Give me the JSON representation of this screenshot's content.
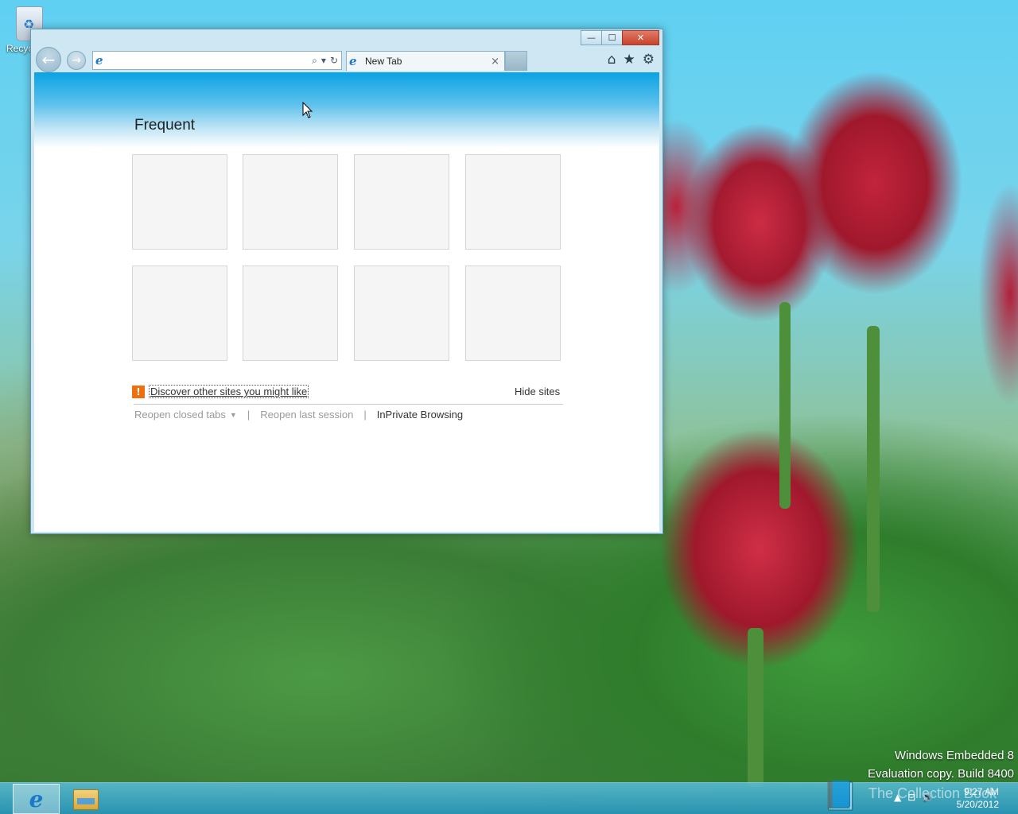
{
  "desktop": {
    "recycle_bin_label": "Recyc"
  },
  "browser": {
    "address_value": "",
    "tab_title": "New Tab",
    "tab_close": "×",
    "window_controls": {
      "minimize": "—",
      "maximize": "☐",
      "close": "✕"
    },
    "nav": {
      "back": "←",
      "forward": "→"
    },
    "address_icons": {
      "search": "⌕",
      "dropdown": "▾",
      "refresh": "↻"
    },
    "toolbar_icons": {
      "home": "⌂",
      "favorites": "★",
      "tools": "⚙"
    },
    "ie_glyph": "e"
  },
  "newtab": {
    "heading": "Frequent",
    "tile_count": 8,
    "discover_icon": "!",
    "discover_link": "Discover other sites you might like",
    "hide_sites": "Hide sites",
    "reopen_closed_tabs": "Reopen closed tabs",
    "reopen_caret": "▼",
    "separator": "|",
    "reopen_last_session": "Reopen last session",
    "inprivate": "InPrivate Browsing"
  },
  "watermark": {
    "line1": "Windows Embedded 8",
    "line2": "Evaluation copy. Build 8400"
  },
  "taskbar": {
    "ie_glyph": "e",
    "overlay_text": "The Collection Book",
    "clock_time": "9:27 AM",
    "clock_date": "5/20/2012",
    "tray_icons": {
      "arrow": "▲",
      "network": "⊡",
      "volume": "🔊"
    }
  },
  "colors": {
    "accent": "#0aa2e5",
    "close_button": "#c7432c",
    "discover_icon": "#ef6f10"
  }
}
